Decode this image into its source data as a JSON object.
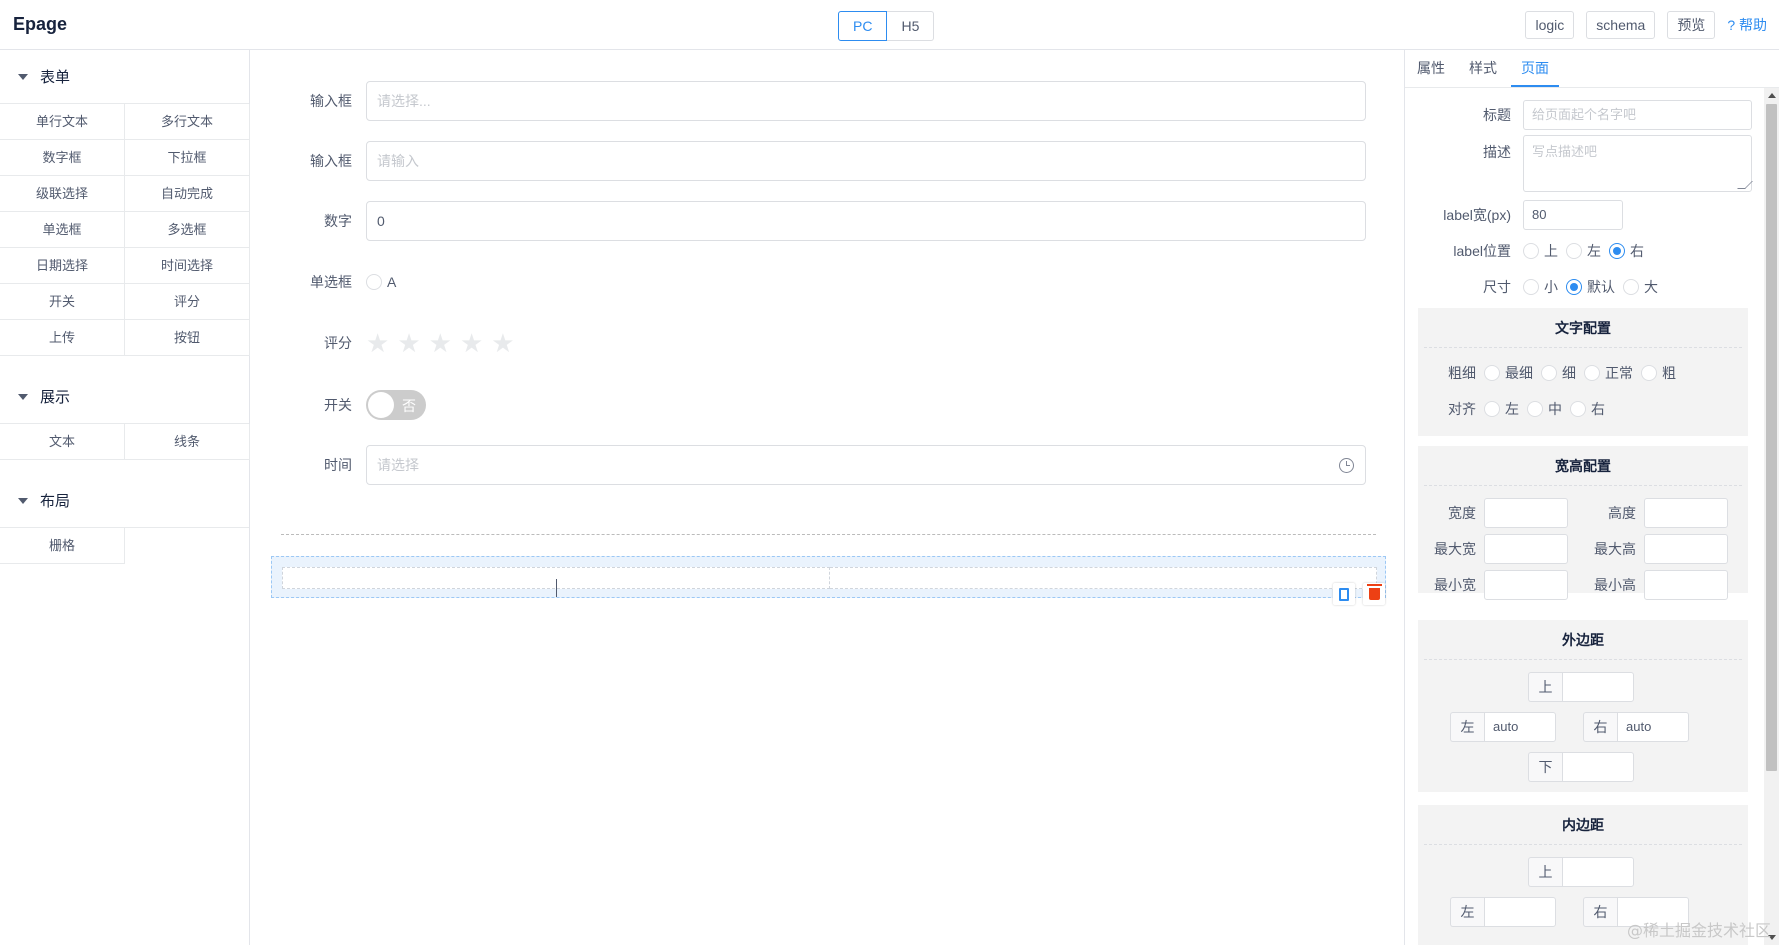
{
  "header": {
    "logo": "Epage",
    "modes": [
      "PC",
      "H5"
    ],
    "actions": {
      "logic": "logic",
      "schema": "schema",
      "preview": "预览",
      "help": "? 帮助"
    }
  },
  "left_panel": {
    "groups": [
      {
        "title": "表单",
        "items": [
          "单行文本",
          "多行文本",
          "数字框",
          "下拉框",
          "级联选择",
          "自动完成",
          "单选框",
          "多选框",
          "日期选择",
          "时间选择",
          "开关",
          "评分",
          "上传",
          "按钮"
        ]
      },
      {
        "title": "展示",
        "items": [
          "文本",
          "线条"
        ]
      },
      {
        "title": "布局",
        "items": [
          "栅格"
        ]
      }
    ]
  },
  "canvas": {
    "fields": {
      "input1": {
        "label": "输入框",
        "placeholder": "请选择..."
      },
      "input2": {
        "label": "输入框",
        "placeholder": "请输入"
      },
      "number": {
        "label": "数字",
        "value": "0"
      },
      "radio": {
        "label": "单选框",
        "option": "A"
      },
      "rate": {
        "label": "评分",
        "stars": 5,
        "value": 0
      },
      "switch": {
        "label": "开关",
        "off_text": "否"
      },
      "time": {
        "label": "时间",
        "placeholder": "请选择"
      }
    }
  },
  "right_panel": {
    "tabs": [
      "属性",
      "样式",
      "页面"
    ],
    "active_tab": "页面",
    "page": {
      "title_label": "标题",
      "title_placeholder": "给页面起个名字吧",
      "desc_label": "描述",
      "desc_placeholder": "写点描述吧",
      "label_width_label": "label宽(px)",
      "label_width_value": "80",
      "label_pos_label": "label位置",
      "label_pos_options": [
        "上",
        "左",
        "右"
      ],
      "label_pos_selected": "右",
      "size_label": "尺寸",
      "size_options": [
        "小",
        "默认",
        "大"
      ],
      "size_selected": "默认"
    },
    "text_config": {
      "title": "文字配置",
      "weight_label": "粗细",
      "weight_options": [
        "最细",
        "细",
        "正常",
        "粗"
      ],
      "align_label": "对齐",
      "align_options": [
        "左",
        "中",
        "右"
      ]
    },
    "size_config": {
      "title": "宽高配置",
      "width": "宽度",
      "height": "高度",
      "max_width": "最大宽",
      "max_height": "最大高",
      "min_width": "最小宽",
      "min_height": "最小高"
    },
    "margin": {
      "title": "外边距",
      "top": "上",
      "left": "左",
      "right": "右",
      "bottom": "下",
      "left_value": "auto",
      "right_value": "auto"
    },
    "padding": {
      "title": "内边距",
      "top": "上",
      "left": "左",
      "right": "右"
    }
  },
  "watermark": "@稀土掘金技术社区"
}
